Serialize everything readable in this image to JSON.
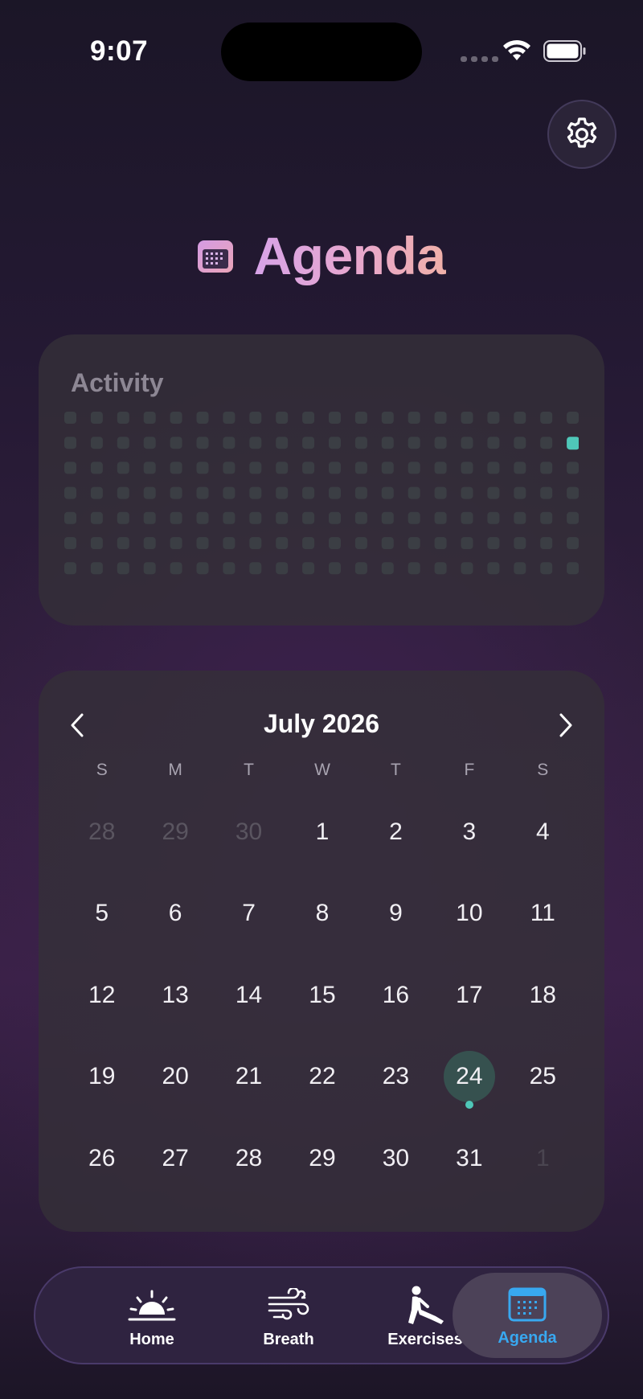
{
  "status_bar": {
    "time": "9:07"
  },
  "header": {
    "title": "Agenda"
  },
  "activity": {
    "title": "Activity",
    "grid": {
      "columns": 20,
      "rows": 7,
      "active": [
        [
          19,
          1
        ]
      ]
    }
  },
  "calendar": {
    "month_label": "July 2026",
    "weekdays": [
      "S",
      "M",
      "T",
      "W",
      "T",
      "F",
      "S"
    ],
    "days": [
      {
        "label": "28",
        "state": "muted"
      },
      {
        "label": "29",
        "state": "muted"
      },
      {
        "label": "30",
        "state": "muted"
      },
      {
        "label": "1"
      },
      {
        "label": "2"
      },
      {
        "label": "3"
      },
      {
        "label": "4"
      },
      {
        "label": "5"
      },
      {
        "label": "6"
      },
      {
        "label": "7"
      },
      {
        "label": "8"
      },
      {
        "label": "9"
      },
      {
        "label": "10"
      },
      {
        "label": "11"
      },
      {
        "label": "12"
      },
      {
        "label": "13"
      },
      {
        "label": "14"
      },
      {
        "label": "15"
      },
      {
        "label": "16"
      },
      {
        "label": "17"
      },
      {
        "label": "18"
      },
      {
        "label": "19"
      },
      {
        "label": "20"
      },
      {
        "label": "21"
      },
      {
        "label": "22"
      },
      {
        "label": "23"
      },
      {
        "label": "24",
        "state": "today",
        "has_event": true
      },
      {
        "label": "25"
      },
      {
        "label": "26"
      },
      {
        "label": "27"
      },
      {
        "label": "28"
      },
      {
        "label": "29"
      },
      {
        "label": "30"
      },
      {
        "label": "31"
      },
      {
        "label": "1",
        "state": "trail"
      }
    ]
  },
  "tabs": {
    "home": "Home",
    "breath": "Breath",
    "exercises": "Exercises",
    "agenda": "Agenda",
    "selected": "agenda"
  },
  "icons": {
    "settings": "gear-icon",
    "title": "calendar-icon",
    "prev": "chevron-left-icon",
    "next": "chevron-right-icon",
    "home": "sunrise-icon",
    "breath": "wind-icon",
    "exercises": "stretch-figure-icon",
    "agenda": "calendar-icon"
  },
  "colors": {
    "accent_teal": "#4fc7b8",
    "today_bg": "#36514f",
    "selected_tab_text": "#38a8f0"
  }
}
